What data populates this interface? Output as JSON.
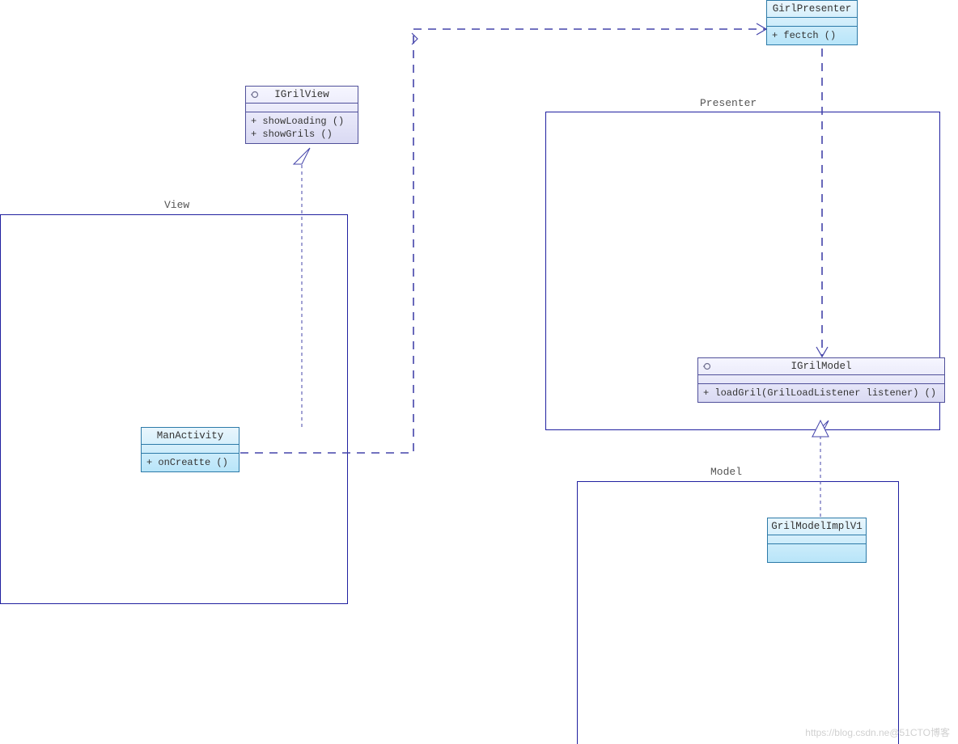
{
  "packages": {
    "view_label": "View",
    "presenter_label": "Presenter",
    "model_label": "Model"
  },
  "classes": {
    "igrilview": {
      "name": "IGrilView",
      "ops": [
        "+ showLoading ()",
        "+ showGrils ()"
      ]
    },
    "manactivity": {
      "name": "ManActivity",
      "ops": [
        "+ onCreatte ()"
      ]
    },
    "girlpresenter": {
      "name": "GirlPresenter",
      "ops": [
        "+ fectch ()"
      ]
    },
    "igrilmodel": {
      "name": "IGrilModel",
      "ops": [
        "+ loadGril(GrilLoadListener listener) ()"
      ]
    },
    "grilmodelimplv1": {
      "name": "GrilModelImplV1"
    }
  },
  "watermark": "https://blog.csdn.ne@51CTO博客"
}
